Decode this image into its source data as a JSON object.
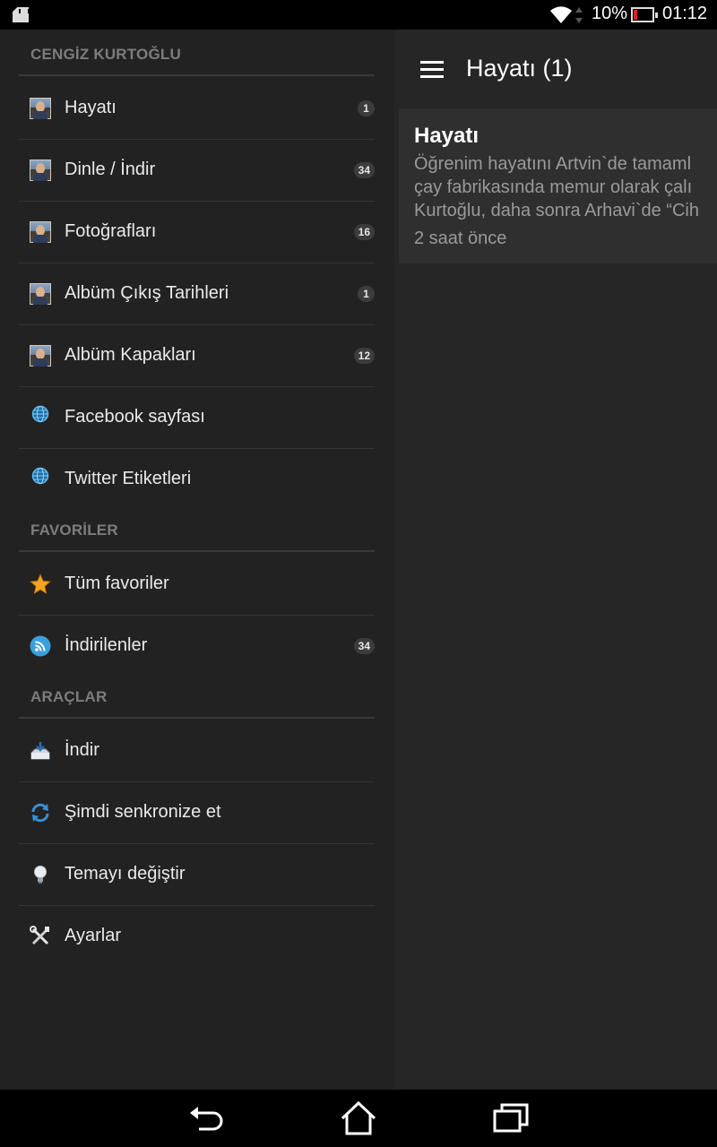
{
  "status_bar": {
    "battery_percent": "10%",
    "time": "01:12",
    "icons": [
      "sd-card-icon",
      "wifi-icon",
      "data-arrows-icon",
      "battery-icon"
    ]
  },
  "drawer": {
    "sections": [
      {
        "header": "CENGİZ KURTOĞLU",
        "items": [
          {
            "label": "Hayatı",
            "badge": "1",
            "icon": "avatar-icon"
          },
          {
            "label": "Dinle / İndir",
            "badge": "34",
            "icon": "avatar-icon"
          },
          {
            "label": "Fotoğrafları",
            "badge": "16",
            "icon": "avatar-icon"
          },
          {
            "label": "Albüm Çıkış Tarihleri",
            "badge": "1",
            "icon": "avatar-icon"
          },
          {
            "label": "Albüm Kapakları",
            "badge": "12",
            "icon": "avatar-icon"
          },
          {
            "label": "Facebook sayfası",
            "icon": "globe-icon"
          },
          {
            "label": "Twitter Etiketleri",
            "icon": "globe-icon"
          }
        ]
      },
      {
        "header": "FAVORİLER",
        "items": [
          {
            "label": "Tüm favoriler",
            "icon": "star-icon"
          },
          {
            "label": "İndirilenler",
            "badge": "34",
            "icon": "rss-icon"
          }
        ]
      },
      {
        "header": "ARAÇLAR",
        "items": [
          {
            "label": "İndir",
            "icon": "download-tray-icon"
          },
          {
            "label": "Şimdi senkronize et",
            "icon": "sync-icon"
          },
          {
            "label": "Temayı değiştir",
            "icon": "lightbulb-icon"
          },
          {
            "label": "Ayarlar",
            "icon": "tools-icon"
          }
        ]
      }
    ]
  },
  "appbar": {
    "title": "Hayatı (1)"
  },
  "card": {
    "title": "Hayatı",
    "lines": [
      "Öğrenim hayatını Artvin`de tamaml",
      "çay fabrikasında memur olarak çalı",
      "Kurtoğlu, daha sonra Arhavi`de “Cih"
    ],
    "time": "2 saat önce"
  },
  "colors": {
    "drawer_bg": "#222222",
    "main_bg": "#262626",
    "card_bg": "#2f2f2f",
    "section_header": "#7d7d7d",
    "badge_bg": "#3c3c3c",
    "battery_low": "#e02020"
  }
}
